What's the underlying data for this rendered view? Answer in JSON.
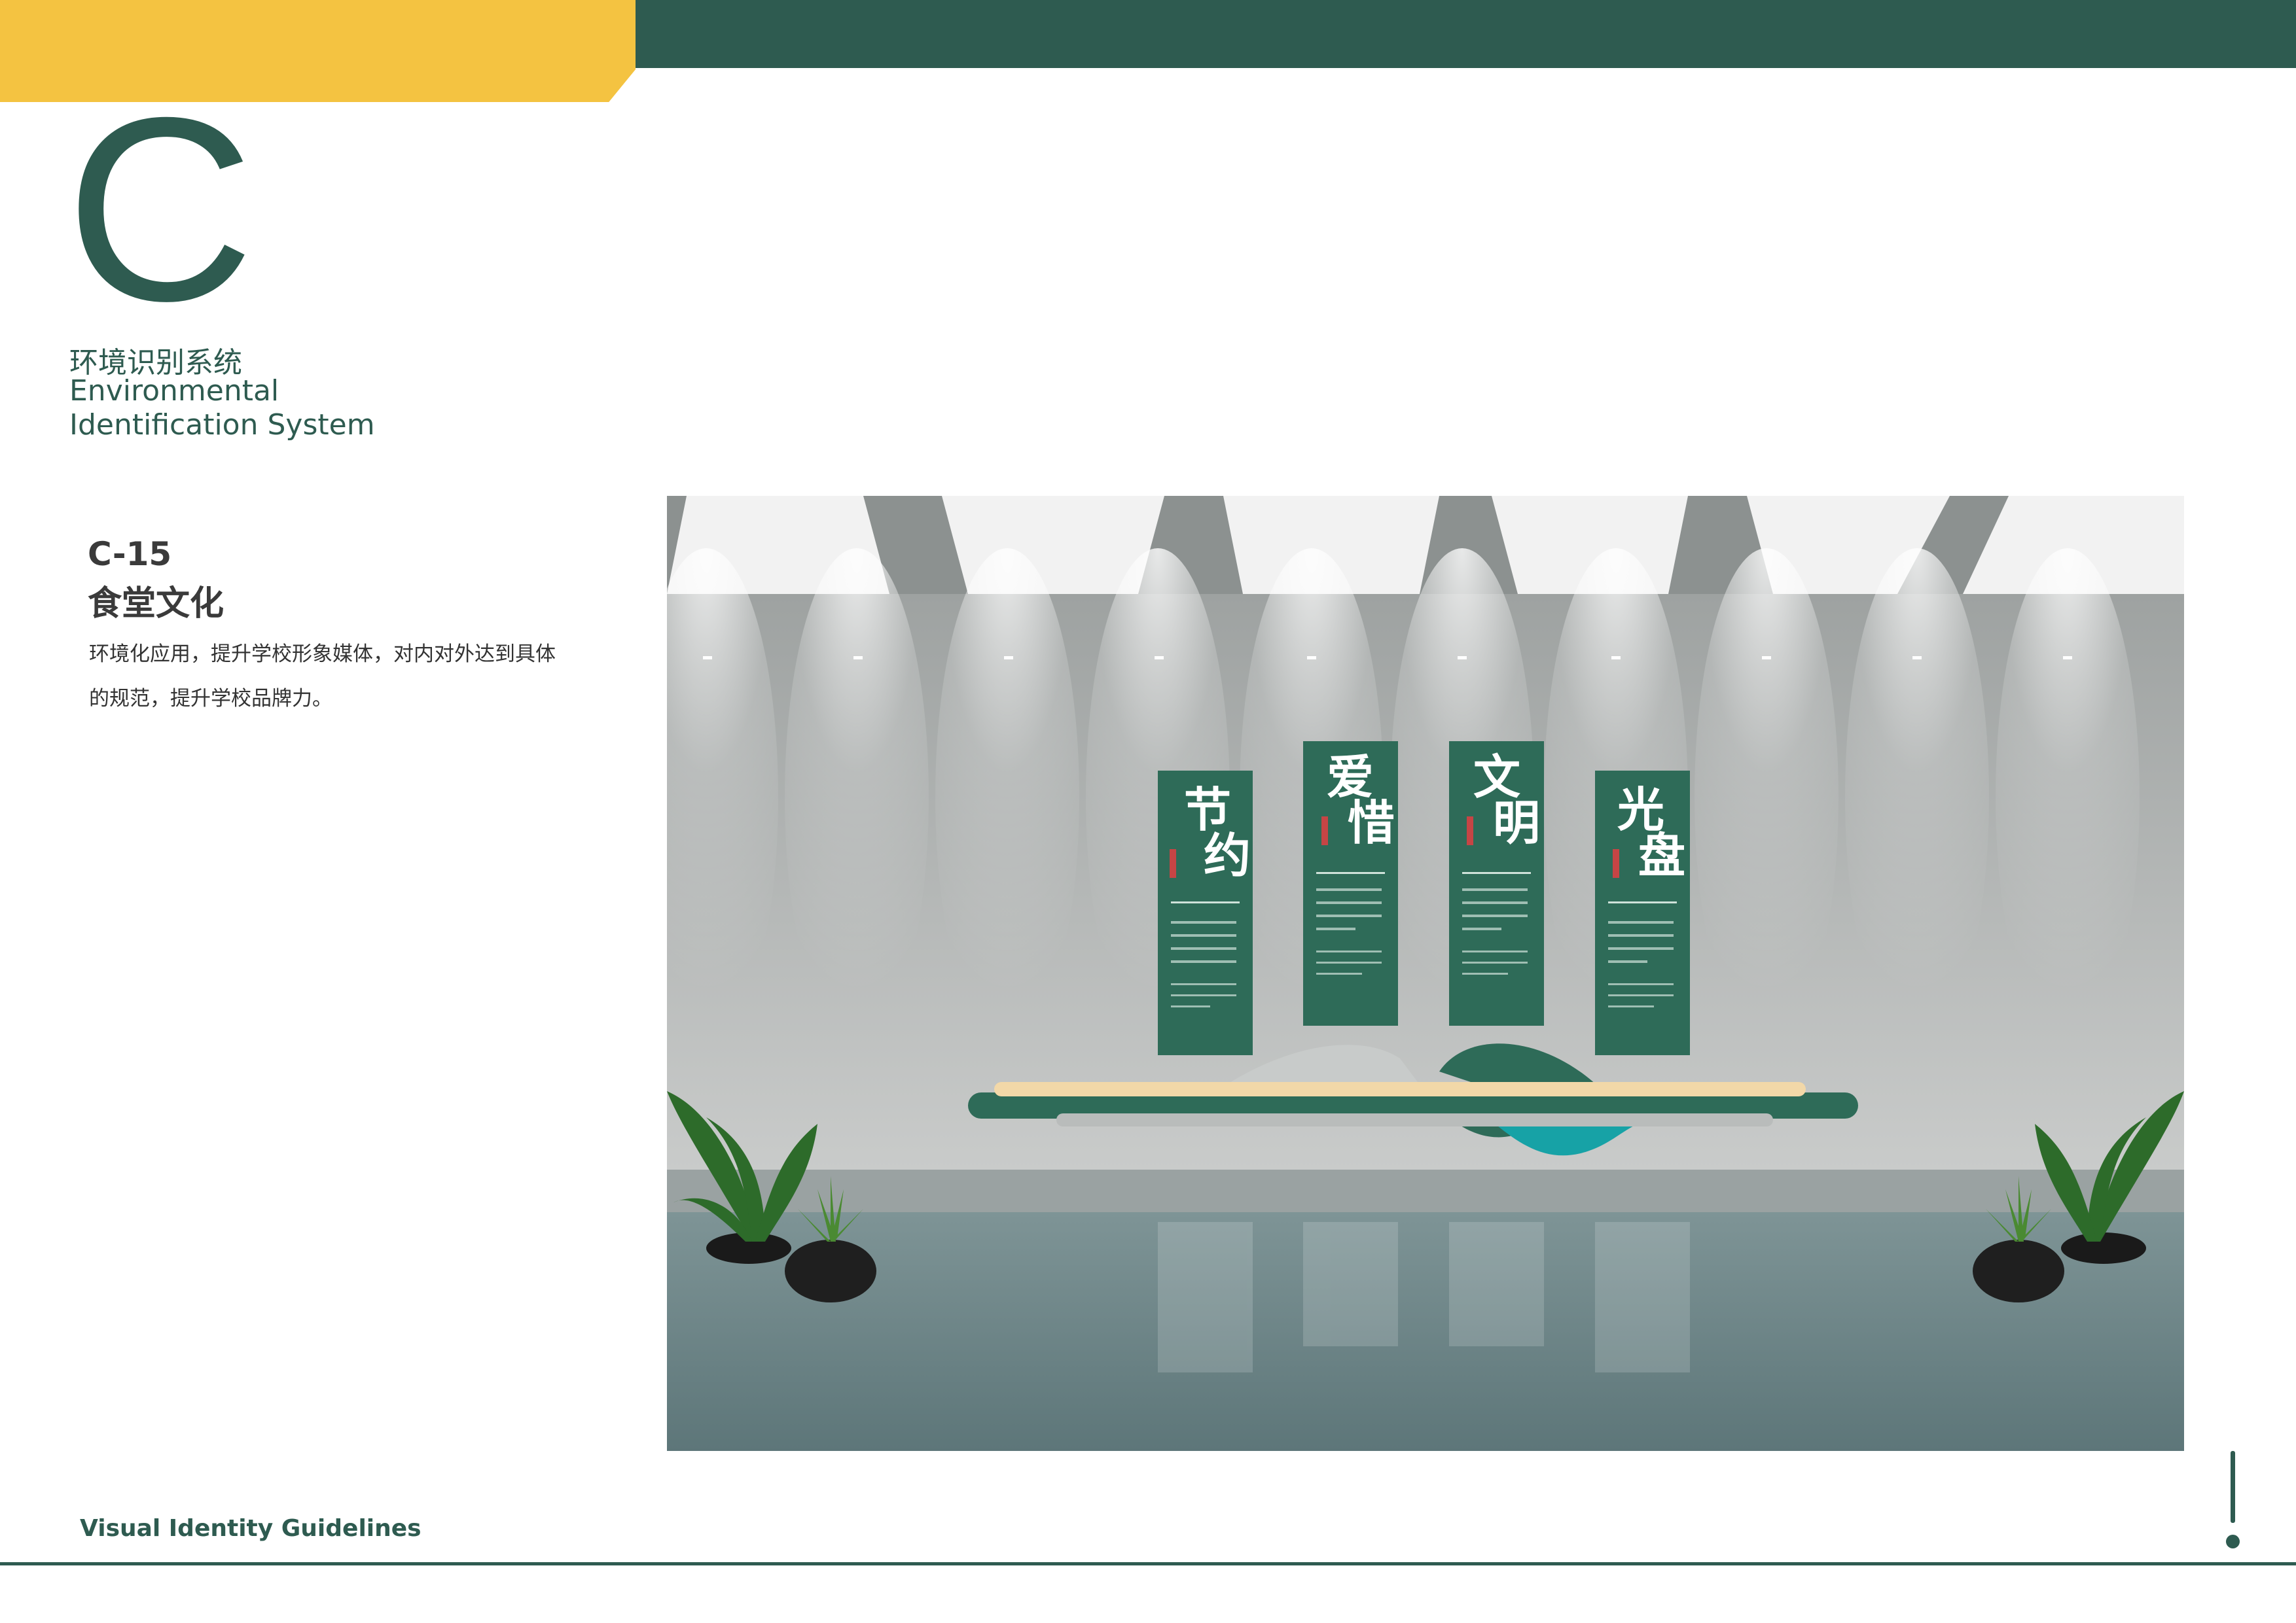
{
  "header": {
    "section_letter": "C",
    "section_title_cn": "环境识别系统",
    "section_title_en": "Environmental Identification System"
  },
  "item": {
    "code": "C-15",
    "title": "食堂文化",
    "description": "环境化应用，提升学校形象媒体，对内对外达到具体的规范，提升学校品牌力。"
  },
  "photo": {
    "panels": [
      {
        "char1": "节",
        "char2": "约"
      },
      {
        "char1": "爱",
        "char2": "惜"
      },
      {
        "char1": "文",
        "char2": "明"
      },
      {
        "char1": "光",
        "char2": "盘"
      }
    ]
  },
  "footer": {
    "text": "Visual Identity Guidelines"
  },
  "colors": {
    "primary_green": "#2e5b50",
    "accent_yellow": "#f4c341"
  }
}
